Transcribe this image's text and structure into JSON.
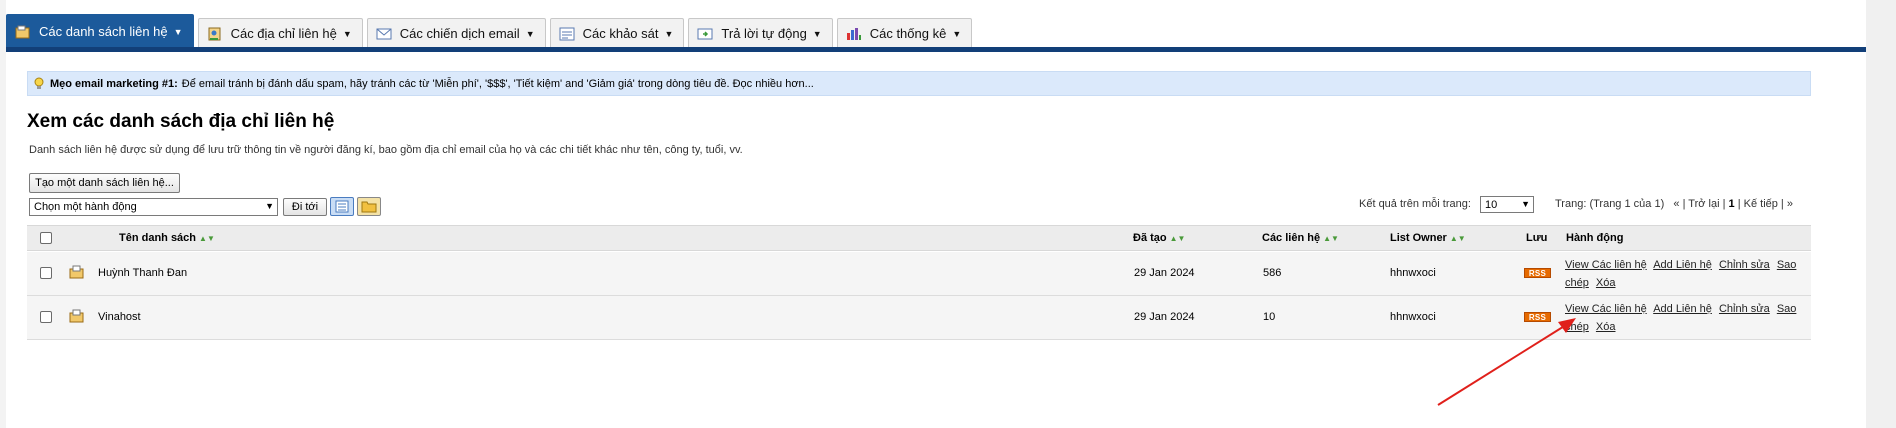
{
  "tabs": [
    {
      "label": "Các danh sách liên hệ",
      "icon": "contact-list-icon",
      "active": true
    },
    {
      "label": "Các địa chỉ liên hệ",
      "icon": "address-book-icon",
      "active": false
    },
    {
      "label": "Các chiến dịch email",
      "icon": "envelope-icon",
      "active": false
    },
    {
      "label": "Các khảo sát",
      "icon": "survey-icon",
      "active": false
    },
    {
      "label": "Trả lời tự động",
      "icon": "autoresponder-icon",
      "active": false
    },
    {
      "label": "Các thống kê",
      "icon": "bar-chart-icon",
      "active": false
    }
  ],
  "tip": {
    "title": "Mẹo email marketing #1:",
    "text": "Để email tránh bị đánh dấu spam, hãy tránh các từ 'Miễn phí', '$$$', 'Tiết kiệm' and 'Giảm giá' trong dòng tiêu đề. Đọc nhiều hơn..."
  },
  "page": {
    "title": "Xem các danh sách địa chỉ liên hệ",
    "description": "Danh sách liên hệ được sử dụng để lưu trữ thông tin về người đăng kí, bao gồm địa chỉ email của họ và các chi tiết khác như tên, công ty, tuổi, vv."
  },
  "toolbar": {
    "create_label": "Tạo một danh sách liên hệ...",
    "action_select": "Chọn một hành động",
    "go_label": "Đi tới",
    "perpage_label": "Kết quả trên mỗi trang:",
    "perpage_value": "10",
    "paging_text": "Trang: (Trang 1 của 1)",
    "paging_nav_prefix": "« | Trở lại |",
    "paging_current": "1",
    "paging_nav_suffix": "| Kế tiếp | »"
  },
  "table": {
    "columns": {
      "name": "Tên danh sách",
      "created": "Đã tạo",
      "contacts": "Các liên hệ",
      "owner": "List Owner",
      "save": "Lưu",
      "actions": "Hành động"
    },
    "rows": [
      {
        "name": "Huỳnh Thanh Đan",
        "created": "29 Jan 2024",
        "contacts": "586",
        "owner": "hhnwxoci",
        "rss": "RSS",
        "actions": {
          "view": "View Các liên hệ",
          "add": "Add Liên hệ",
          "edit": "Chỉnh sửa",
          "copy": "Sao chép",
          "delete": "Xóa"
        }
      },
      {
        "name": "Vinahost",
        "created": "29 Jan 2024",
        "contacts": "10",
        "owner": "hhnwxoci",
        "rss": "RSS",
        "actions": {
          "view": "View Các liên hệ",
          "add": "Add Liên hệ",
          "edit": "Chỉnh sửa",
          "copy": "Sao chép",
          "delete": "Xóa"
        }
      }
    ]
  },
  "colors": {
    "tab_active": "#1c5a9b",
    "nav_bar": "#123f78",
    "tip_bg": "#dbe9fb",
    "rss": "#e66a00",
    "annotation_arrow": "#e0201b"
  }
}
